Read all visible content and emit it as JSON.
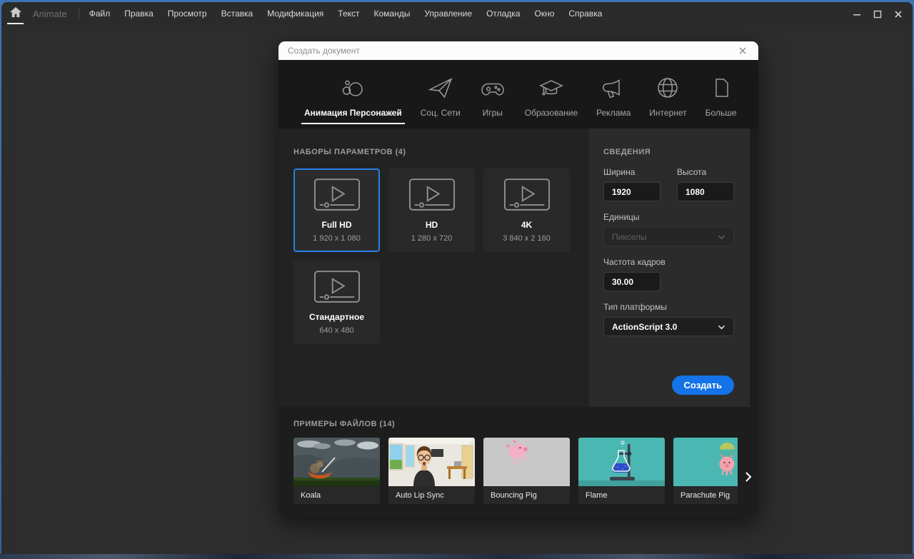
{
  "window": {
    "app_name": "Animate",
    "menu_items": [
      "Файл",
      "Правка",
      "Просмотр",
      "Вставка",
      "Модификация",
      "Текст",
      "Команды",
      "Управление",
      "Отладка",
      "Окно",
      "Справка"
    ]
  },
  "dialog": {
    "title": "Создать документ",
    "tabs": [
      {
        "label": "Анимация Персонажей",
        "icon": "character-animation-icon",
        "selected": true
      },
      {
        "label": "Соц. Сети",
        "icon": "paper-plane-icon"
      },
      {
        "label": "Игры",
        "icon": "gamepad-icon"
      },
      {
        "label": "Образование",
        "icon": "graduation-cap-icon"
      },
      {
        "label": "Реклама",
        "icon": "megaphone-icon"
      },
      {
        "label": "Интернет",
        "icon": "globe-icon"
      },
      {
        "label": "Больше",
        "icon": "document-icon"
      }
    ],
    "presets": {
      "header": "НАБОРЫ ПАРАМЕТРОВ (4)",
      "items": [
        {
          "name": "Full HD",
          "dimensions": "1 920 x 1 080",
          "selected": true
        },
        {
          "name": "HD",
          "dimensions": "1 280 x 720"
        },
        {
          "name": "4K",
          "dimensions": "3 840 x 2 160"
        },
        {
          "name": "Стандартное",
          "dimensions": "640 x 480"
        }
      ]
    },
    "details": {
      "header": "СВЕДЕНИЯ",
      "width_label": "Ширина",
      "width_value": "1920",
      "height_label": "Высота",
      "height_value": "1080",
      "units_label": "Единицы",
      "units_value": "Пикселы",
      "framerate_label": "Частота кадров",
      "framerate_value": "30.00",
      "platform_label": "Тип платформы",
      "platform_value": "ActionScript 3.0",
      "create_label": "Создать"
    },
    "samples": {
      "header": "ПРИМЕРЫ ФАЙЛОВ (14)",
      "items": [
        {
          "label": "Koala",
          "art": "koala-thumb"
        },
        {
          "label": "Auto Lip Sync",
          "art": "autolipsync-thumb"
        },
        {
          "label": "Bouncing Pig",
          "art": "bouncingpig-thumb"
        },
        {
          "label": "Flame",
          "art": "flame-thumb"
        },
        {
          "label": "Parachute Pig",
          "art": "parachutepig-thumb"
        }
      ]
    },
    "colors": {
      "accent": "#1473e6",
      "selection": "#2680eb",
      "sample_teal": "#4bb7b2"
    }
  }
}
